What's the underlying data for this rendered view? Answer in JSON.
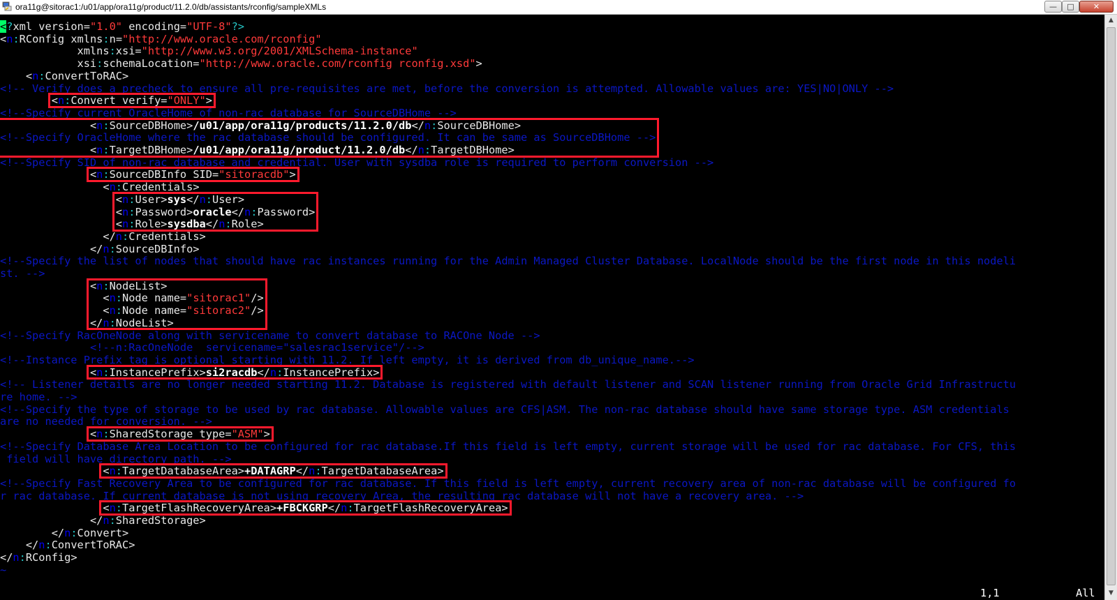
{
  "window": {
    "title": "ora11g@sitorac1:/u01/app/ora11g/product/11.2.0/db/assistants/rconfig/sampleXMLs",
    "minimize_glyph": "—",
    "maximize_glyph": "□",
    "close_glyph": "✕"
  },
  "editor": {
    "lines": [
      {
        "indent": "",
        "parts": [
          {
            "c": "cur",
            "t": "<"
          },
          {
            "c": "pc",
            "t": "?"
          },
          {
            "c": "at",
            "t": "xml version="
          },
          {
            "c": "st",
            "t": "\"1.0\""
          },
          {
            "c": "at",
            "t": " encoding="
          },
          {
            "c": "st",
            "t": "\"UTF-8\""
          },
          {
            "c": "pc",
            "t": "?>"
          }
        ]
      },
      {
        "indent": "",
        "parts": [
          {
            "c": "tg",
            "t": "<"
          },
          {
            "c": "ns",
            "t": "n"
          },
          {
            "c": "pc",
            "t": ":"
          },
          {
            "c": "tg",
            "t": "RConfig xmlns"
          },
          {
            "c": "pc",
            "t": ":"
          },
          {
            "c": "tg",
            "t": "n="
          },
          {
            "c": "st",
            "t": "\"http://www.oracle.com/rconfig\""
          }
        ]
      },
      {
        "indent": "            ",
        "parts": [
          {
            "c": "tg",
            "t": "xmlns"
          },
          {
            "c": "pc",
            "t": ":"
          },
          {
            "c": "tg",
            "t": "xsi="
          },
          {
            "c": "st",
            "t": "\"http://www.w3.org/2001/XMLSchema-instance\""
          }
        ]
      },
      {
        "indent": "            ",
        "parts": [
          {
            "c": "tg",
            "t": "xsi"
          },
          {
            "c": "pc",
            "t": ":"
          },
          {
            "c": "tg",
            "t": "schemaLocation="
          },
          {
            "c": "st",
            "t": "\"http://www.oracle.com/rconfig rconfig.xsd\""
          },
          {
            "c": "tg",
            "t": ">"
          }
        ]
      },
      {
        "indent": "    ",
        "parts": [
          {
            "c": "tg",
            "t": "<"
          },
          {
            "c": "ns",
            "t": "n"
          },
          {
            "c": "pc",
            "t": ":"
          },
          {
            "c": "tg",
            "t": "ConvertToRAC>"
          }
        ]
      },
      {
        "indent": "",
        "parts": [
          {
            "c": "co",
            "t": "<!-- Verify does a precheck to ensure all pre-requisites are met, before the conversion is attempted. Allowable values are: YES|NO|ONLY -->"
          }
        ]
      },
      {
        "indent": "        ",
        "parts": [
          {
            "c": "tg",
            "t": "<"
          },
          {
            "c": "ns",
            "t": "n"
          },
          {
            "c": "pc",
            "t": ":"
          },
          {
            "c": "tg",
            "t": "Convert verify="
          },
          {
            "c": "st",
            "t": "\"ONLY\""
          },
          {
            "c": "tg",
            "t": ">"
          }
        ]
      },
      {
        "indent": "",
        "parts": [
          {
            "c": "co",
            "t": "<!--Specify current OracleHome of non-rac database for SourceDBHome -->"
          }
        ]
      },
      {
        "indent": "              ",
        "parts": [
          {
            "c": "tg",
            "t": "<"
          },
          {
            "c": "ns",
            "t": "n"
          },
          {
            "c": "pc",
            "t": ":"
          },
          {
            "c": "tg",
            "t": "SourceDBHome>"
          },
          {
            "c": "tx",
            "t": "/u01/app/ora11g/products/11.2.0/db"
          },
          {
            "c": "tg",
            "t": "</"
          },
          {
            "c": "ns",
            "t": "n"
          },
          {
            "c": "pc",
            "t": ":"
          },
          {
            "c": "tg",
            "t": "SourceDBHome>"
          }
        ]
      },
      {
        "indent": "",
        "parts": [
          {
            "c": "co",
            "t": "<!--Specify OracleHome where the rac database should be configured. It can be same as SourceDBHome -->"
          }
        ]
      },
      {
        "indent": "              ",
        "parts": [
          {
            "c": "tg",
            "t": "<"
          },
          {
            "c": "ns",
            "t": "n"
          },
          {
            "c": "pc",
            "t": ":"
          },
          {
            "c": "tg",
            "t": "TargetDBHome>"
          },
          {
            "c": "tx",
            "t": "/u01/app/ora11g/product/11.2.0/db"
          },
          {
            "c": "tg",
            "t": "</"
          },
          {
            "c": "ns",
            "t": "n"
          },
          {
            "c": "pc",
            "t": ":"
          },
          {
            "c": "tg",
            "t": "TargetDBHome>"
          }
        ]
      },
      {
        "indent": "",
        "parts": [
          {
            "c": "co",
            "t": "<!--Specify SID of non-rac database and credential. User with sysdba role is required to perform conversion -->"
          }
        ]
      },
      {
        "indent": "              ",
        "parts": [
          {
            "c": "tg",
            "t": "<"
          },
          {
            "c": "ns",
            "t": "n"
          },
          {
            "c": "pc",
            "t": ":"
          },
          {
            "c": "tg",
            "t": "SourceDBInfo SID="
          },
          {
            "c": "st",
            "t": "\"sitoracdb\""
          },
          {
            "c": "tg",
            "t": ">"
          }
        ]
      },
      {
        "indent": "                ",
        "parts": [
          {
            "c": "tg",
            "t": "<"
          },
          {
            "c": "ns",
            "t": "n"
          },
          {
            "c": "pc",
            "t": ":"
          },
          {
            "c": "tg",
            "t": "Credentials>"
          }
        ]
      },
      {
        "indent": "                  ",
        "parts": [
          {
            "c": "tg",
            "t": "<"
          },
          {
            "c": "ns",
            "t": "n"
          },
          {
            "c": "pc",
            "t": ":"
          },
          {
            "c": "tg",
            "t": "User>"
          },
          {
            "c": "tx",
            "t": "sys"
          },
          {
            "c": "tg",
            "t": "</"
          },
          {
            "c": "ns",
            "t": "n"
          },
          {
            "c": "pc",
            "t": ":"
          },
          {
            "c": "tg",
            "t": "User>"
          }
        ]
      },
      {
        "indent": "                  ",
        "parts": [
          {
            "c": "tg",
            "t": "<"
          },
          {
            "c": "ns",
            "t": "n"
          },
          {
            "c": "pc",
            "t": ":"
          },
          {
            "c": "tg",
            "t": "Password>"
          },
          {
            "c": "tx",
            "t": "oracle"
          },
          {
            "c": "tg",
            "t": "</"
          },
          {
            "c": "ns",
            "t": "n"
          },
          {
            "c": "pc",
            "t": ":"
          },
          {
            "c": "tg",
            "t": "Password>"
          }
        ]
      },
      {
        "indent": "                  ",
        "parts": [
          {
            "c": "tg",
            "t": "<"
          },
          {
            "c": "ns",
            "t": "n"
          },
          {
            "c": "pc",
            "t": ":"
          },
          {
            "c": "tg",
            "t": "Role>"
          },
          {
            "c": "tx",
            "t": "sysdba"
          },
          {
            "c": "tg",
            "t": "</"
          },
          {
            "c": "ns",
            "t": "n"
          },
          {
            "c": "pc",
            "t": ":"
          },
          {
            "c": "tg",
            "t": "Role>"
          }
        ]
      },
      {
        "indent": "                ",
        "parts": [
          {
            "c": "tg",
            "t": "</"
          },
          {
            "c": "ns",
            "t": "n"
          },
          {
            "c": "pc",
            "t": ":"
          },
          {
            "c": "tg",
            "t": "Credentials>"
          }
        ]
      },
      {
        "indent": "              ",
        "parts": [
          {
            "c": "tg",
            "t": "</"
          },
          {
            "c": "ns",
            "t": "n"
          },
          {
            "c": "pc",
            "t": ":"
          },
          {
            "c": "tg",
            "t": "SourceDBInfo>"
          }
        ]
      },
      {
        "indent": "",
        "parts": [
          {
            "c": "co",
            "t": "<!--Specify the list of nodes that should have rac instances running for the Admin Managed Cluster Database. LocalNode should be the first node in this nodeli"
          }
        ]
      },
      {
        "indent": "",
        "parts": [
          {
            "c": "co",
            "t": "st. -->"
          }
        ]
      },
      {
        "indent": "              ",
        "parts": [
          {
            "c": "tg",
            "t": "<"
          },
          {
            "c": "ns",
            "t": "n"
          },
          {
            "c": "pc",
            "t": ":"
          },
          {
            "c": "tg",
            "t": "NodeList>"
          }
        ]
      },
      {
        "indent": "                ",
        "parts": [
          {
            "c": "tg",
            "t": "<"
          },
          {
            "c": "ns",
            "t": "n"
          },
          {
            "c": "pc",
            "t": ":"
          },
          {
            "c": "tg",
            "t": "Node name="
          },
          {
            "c": "st",
            "t": "\"sitorac1\""
          },
          {
            "c": "tg",
            "t": "/>"
          }
        ]
      },
      {
        "indent": "                ",
        "parts": [
          {
            "c": "tg",
            "t": "<"
          },
          {
            "c": "ns",
            "t": "n"
          },
          {
            "c": "pc",
            "t": ":"
          },
          {
            "c": "tg",
            "t": "Node name="
          },
          {
            "c": "st",
            "t": "\"sitorac2\""
          },
          {
            "c": "tg",
            "t": "/>"
          }
        ]
      },
      {
        "indent": "              ",
        "parts": [
          {
            "c": "tg",
            "t": "</"
          },
          {
            "c": "ns",
            "t": "n"
          },
          {
            "c": "pc",
            "t": ":"
          },
          {
            "c": "tg",
            "t": "NodeList>"
          }
        ]
      },
      {
        "indent": "",
        "parts": [
          {
            "c": "co",
            "t": "<!--Specify RacOneNode along with servicename to convert database to RACOne Node -->"
          }
        ]
      },
      {
        "indent": "              ",
        "parts": [
          {
            "c": "co",
            "t": "<!--n:RacOneNode  servicename=\"salesrac1service\"/-->"
          }
        ]
      },
      {
        "indent": "",
        "parts": [
          {
            "c": "co",
            "t": "<!--Instance Prefix tag is optional starting with 11.2. If left empty, it is derived from db_unique_name.-->"
          }
        ]
      },
      {
        "indent": "              ",
        "parts": [
          {
            "c": "tg",
            "t": "<"
          },
          {
            "c": "ns",
            "t": "n"
          },
          {
            "c": "pc",
            "t": ":"
          },
          {
            "c": "tg",
            "t": "InstancePrefix>"
          },
          {
            "c": "tx",
            "t": "si2racdb"
          },
          {
            "c": "tg",
            "t": "</"
          },
          {
            "c": "ns",
            "t": "n"
          },
          {
            "c": "pc",
            "t": ":"
          },
          {
            "c": "tg",
            "t": "InstancePrefix>"
          }
        ]
      },
      {
        "indent": "",
        "parts": [
          {
            "c": "co",
            "t": "<!-- Listener details are no longer needed starting 11.2. Database is registered with default listener and SCAN listener running from Oracle Grid Infrastructu"
          }
        ]
      },
      {
        "indent": "",
        "parts": [
          {
            "c": "co",
            "t": "re home. -->"
          }
        ]
      },
      {
        "indent": "",
        "parts": [
          {
            "c": "co",
            "t": "<!--Specify the type of storage to be used by rac database. Allowable values are CFS|ASM. The non-rac database should have same storage type. ASM credentials"
          }
        ]
      },
      {
        "indent": "",
        "parts": [
          {
            "c": "co",
            "t": "are no needed for conversion. -->"
          }
        ]
      },
      {
        "indent": "              ",
        "parts": [
          {
            "c": "tg",
            "t": "<"
          },
          {
            "c": "ns",
            "t": "n"
          },
          {
            "c": "pc",
            "t": ":"
          },
          {
            "c": "tg",
            "t": "SharedStorage type="
          },
          {
            "c": "st",
            "t": "\"ASM\""
          },
          {
            "c": "tg",
            "t": ">"
          }
        ]
      },
      {
        "indent": "",
        "parts": [
          {
            "c": "co",
            "t": "<!--Specify Database Area Location to be configured for rac database.If this field is left empty, current storage will be used for rac database. For CFS, this"
          }
        ]
      },
      {
        "indent": "",
        "parts": [
          {
            "c": "co",
            "t": " field will have directory path. -->"
          }
        ]
      },
      {
        "indent": "                ",
        "parts": [
          {
            "c": "tg",
            "t": "<"
          },
          {
            "c": "ns",
            "t": "n"
          },
          {
            "c": "pc",
            "t": ":"
          },
          {
            "c": "tg",
            "t": "TargetDatabaseArea>"
          },
          {
            "c": "tx",
            "t": "+DATAGRP"
          },
          {
            "c": "tg",
            "t": "</"
          },
          {
            "c": "ns",
            "t": "n"
          },
          {
            "c": "pc",
            "t": ":"
          },
          {
            "c": "tg",
            "t": "TargetDatabaseArea>"
          }
        ]
      },
      {
        "indent": "",
        "parts": [
          {
            "c": "co",
            "t": "<!--Specify Fast Recovery Area to be configured for rac database. If this field is left empty, current recovery area of non-rac database will be configured fo"
          }
        ]
      },
      {
        "indent": "",
        "parts": [
          {
            "c": "co",
            "t": "r rac database. If current database is not using recovery Area, the resulting rac database will not have a recovery area. -->"
          }
        ]
      },
      {
        "indent": "                ",
        "parts": [
          {
            "c": "tg",
            "t": "<"
          },
          {
            "c": "ns",
            "t": "n"
          },
          {
            "c": "pc",
            "t": ":"
          },
          {
            "c": "tg",
            "t": "TargetFlashRecoveryArea>"
          },
          {
            "c": "tx",
            "t": "+FBCKGRP"
          },
          {
            "c": "tg",
            "t": "</"
          },
          {
            "c": "ns",
            "t": "n"
          },
          {
            "c": "pc",
            "t": ":"
          },
          {
            "c": "tg",
            "t": "TargetFlashRecoveryArea>"
          }
        ]
      },
      {
        "indent": "              ",
        "parts": [
          {
            "c": "tg",
            "t": "</"
          },
          {
            "c": "ns",
            "t": "n"
          },
          {
            "c": "pc",
            "t": ":"
          },
          {
            "c": "tg",
            "t": "SharedStorage>"
          }
        ]
      },
      {
        "indent": "        ",
        "parts": [
          {
            "c": "tg",
            "t": "</"
          },
          {
            "c": "ns",
            "t": "n"
          },
          {
            "c": "pc",
            "t": ":"
          },
          {
            "c": "tg",
            "t": "Convert>"
          }
        ]
      },
      {
        "indent": "    ",
        "parts": [
          {
            "c": "tg",
            "t": "</"
          },
          {
            "c": "ns",
            "t": "n"
          },
          {
            "c": "pc",
            "t": ":"
          },
          {
            "c": "tg",
            "t": "ConvertToRAC>"
          }
        ]
      },
      {
        "indent": "",
        "parts": [
          {
            "c": "tg",
            "t": "</"
          },
          {
            "c": "ns",
            "t": "n"
          },
          {
            "c": "pc",
            "t": ":"
          },
          {
            "c": "tg",
            "t": "RConfig>"
          }
        ]
      },
      {
        "indent": "",
        "parts": [
          {
            "c": "co",
            "t": "~"
          }
        ]
      }
    ],
    "highlights": [
      {
        "name": "convert-verify",
        "row": 6,
        "row_end": 6
      },
      {
        "name": "db-homes",
        "row": 8,
        "row_end": 10
      },
      {
        "name": "source-db-info",
        "row": 12,
        "row_end": 12
      },
      {
        "name": "credentials",
        "row": 14,
        "row_end": 16
      },
      {
        "name": "node-list",
        "row": 21,
        "row_end": 24
      },
      {
        "name": "instance-prefix",
        "row": 28,
        "row_end": 28
      },
      {
        "name": "shared-storage",
        "row": 33,
        "row_end": 33
      },
      {
        "name": "target-database-area",
        "row": 36,
        "row_end": 36
      },
      {
        "name": "target-flash-recovery-area",
        "row": 39,
        "row_end": 39
      }
    ]
  },
  "status": {
    "cursor_position": "1,1",
    "scroll": "All"
  },
  "colors": {
    "background": "#000000",
    "comment": "#0b17c4",
    "namespace": "#0000ee",
    "string": "#ff3a3a",
    "punctuation": "#25c5c5",
    "highlight_box": "#ff1a2d",
    "cursor": "#00ff66"
  },
  "icons": {
    "app": "putty-terminal-icon"
  }
}
